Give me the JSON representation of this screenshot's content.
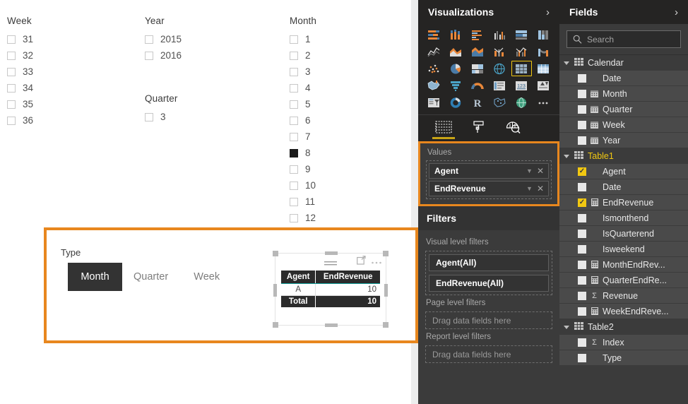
{
  "canvas": {
    "slicers": [
      {
        "name": "week-slicer",
        "title": "Week",
        "items": [
          {
            "label": "31",
            "checked": false
          },
          {
            "label": "32",
            "checked": false
          },
          {
            "label": "33",
            "checked": false
          },
          {
            "label": "34",
            "checked": false
          },
          {
            "label": "35",
            "checked": false
          },
          {
            "label": "36",
            "checked": false
          }
        ]
      },
      {
        "name": "year-slicer",
        "title": "Year",
        "items": [
          {
            "label": "2015",
            "checked": false
          },
          {
            "label": "2016",
            "checked": false
          }
        ]
      },
      {
        "name": "quarter-slicer",
        "title": "Quarter",
        "items": [
          {
            "label": "3",
            "checked": false
          }
        ]
      },
      {
        "name": "month-slicer",
        "title": "Month",
        "items": [
          {
            "label": "1",
            "checked": false
          },
          {
            "label": "2",
            "checked": false
          },
          {
            "label": "3",
            "checked": false
          },
          {
            "label": "4",
            "checked": false
          },
          {
            "label": "5",
            "checked": false
          },
          {
            "label": "6",
            "checked": false
          },
          {
            "label": "7",
            "checked": false
          },
          {
            "label": "8",
            "checked": true
          },
          {
            "label": "9",
            "checked": false
          },
          {
            "label": "10",
            "checked": false
          },
          {
            "label": "11",
            "checked": false
          },
          {
            "label": "12",
            "checked": false
          }
        ]
      }
    ],
    "report_region": {
      "type_label": "Type",
      "tiles": [
        {
          "label": "Month",
          "selected": true
        },
        {
          "label": "Quarter",
          "selected": false
        },
        {
          "label": "Week",
          "selected": false
        }
      ],
      "visual": {
        "header_icons": [
          "menu-lines-icon",
          "focus-mode-icon",
          "more-options-icon"
        ],
        "columns": [
          "Agent",
          "EndRevenue"
        ],
        "rows": [
          {
            "agent": "A",
            "endrevenue": "10"
          }
        ],
        "total": {
          "label": "Total",
          "endrevenue": "10"
        },
        "header_accent_color": "#12a19a",
        "header_bg_color": "#2b2b2b"
      }
    },
    "highlight_color": "#e8871e"
  },
  "visualizations": {
    "title": "Visualizations",
    "collapse_icon": "chevron-right-icon",
    "gallery": [
      {
        "name": "stacked-bar-chart",
        "selected": false
      },
      {
        "name": "stacked-column-chart",
        "selected": false
      },
      {
        "name": "clustered-bar-chart",
        "selected": false
      },
      {
        "name": "clustered-column-chart",
        "selected": false
      },
      {
        "name": "100-percent-stacked-bar-chart",
        "selected": false
      },
      {
        "name": "100-percent-stacked-column-chart",
        "selected": false
      },
      {
        "name": "line-chart",
        "selected": false
      },
      {
        "name": "area-chart",
        "selected": false
      },
      {
        "name": "stacked-area-chart",
        "selected": false
      },
      {
        "name": "line-and-stacked-column-chart",
        "selected": false
      },
      {
        "name": "line-and-clustered-column-chart",
        "selected": false
      },
      {
        "name": "ribbon-chart",
        "selected": false
      },
      {
        "name": "scatter-chart",
        "selected": false
      },
      {
        "name": "pie-chart",
        "selected": false
      },
      {
        "name": "treemap-chart",
        "selected": false
      },
      {
        "name": "map-visual",
        "selected": false
      },
      {
        "name": "table-visual",
        "selected": true
      },
      {
        "name": "matrix-visual",
        "selected": false
      },
      {
        "name": "filled-map-visual",
        "selected": false
      },
      {
        "name": "funnel-chart",
        "selected": false
      },
      {
        "name": "gauge-visual",
        "selected": false
      },
      {
        "name": "multi-row-card",
        "selected": false
      },
      {
        "name": "card-visual",
        "selected": false
      },
      {
        "name": "kpi-visual",
        "selected": false
      },
      {
        "name": "slicer-visual",
        "selected": false
      },
      {
        "name": "donut-chart",
        "selected": false
      },
      {
        "name": "r-script-visual",
        "selected": false
      },
      {
        "name": "shape-map-visual",
        "selected": false
      },
      {
        "name": "globe-map-visual",
        "selected": false
      },
      {
        "name": "more-visuals",
        "selected": false
      }
    ],
    "tabs": [
      {
        "name": "fields-tab",
        "icon": "fields-grid-icon",
        "active": true
      },
      {
        "name": "format-tab",
        "icon": "paint-roller-icon",
        "active": false
      },
      {
        "name": "analytics-tab",
        "icon": "analytics-magnifier-icon",
        "active": false
      }
    ],
    "wells": {
      "label": "Values",
      "fields": [
        {
          "name": "Agent"
        },
        {
          "name": "EndRevenue"
        }
      ],
      "highlight_color": "#e8871e"
    },
    "filters": {
      "title": "Filters",
      "sections": [
        {
          "label": "Visual level filters",
          "cards": [
            "Agent(All)",
            "EndRevenue(All)"
          ],
          "placeholder": null
        },
        {
          "label": "Page level filters",
          "cards": [],
          "placeholder": "Drag data fields here"
        },
        {
          "label": "Report level filters",
          "cards": [],
          "placeholder": "Drag data fields here"
        }
      ]
    }
  },
  "fields": {
    "title": "Fields",
    "collapse_icon": "chevron-right-icon",
    "search": {
      "placeholder": "Search",
      "value": "",
      "icon": "search-icon"
    },
    "tables": [
      {
        "name": "Calendar",
        "gold": false,
        "expanded": true,
        "fields": [
          {
            "label": "Date",
            "checked": false,
            "icon": "none"
          },
          {
            "label": "Month",
            "checked": false,
            "icon": "calendar"
          },
          {
            "label": "Quarter",
            "checked": false,
            "icon": "calendar"
          },
          {
            "label": "Week",
            "checked": false,
            "icon": "calendar"
          },
          {
            "label": "Year",
            "checked": false,
            "icon": "calendar"
          }
        ]
      },
      {
        "name": "Table1",
        "gold": true,
        "expanded": true,
        "fields": [
          {
            "label": "Agent",
            "checked": true,
            "icon": "none"
          },
          {
            "label": "Date",
            "checked": false,
            "icon": "none"
          },
          {
            "label": "EndRevenue",
            "checked": true,
            "icon": "measure"
          },
          {
            "label": "Ismonthend",
            "checked": false,
            "icon": "none"
          },
          {
            "label": "IsQuarterend",
            "checked": false,
            "icon": "none"
          },
          {
            "label": "Isweekend",
            "checked": false,
            "icon": "none"
          },
          {
            "label": "MonthEndRev...",
            "checked": false,
            "icon": "measure"
          },
          {
            "label": "QuarterEndRe...",
            "checked": false,
            "icon": "measure"
          },
          {
            "label": "Revenue",
            "checked": false,
            "icon": "sigma"
          },
          {
            "label": "WeekEndReve...",
            "checked": false,
            "icon": "measure"
          }
        ]
      },
      {
        "name": "Table2",
        "gold": false,
        "expanded": true,
        "fields": [
          {
            "label": "Index",
            "checked": false,
            "icon": "sigma"
          },
          {
            "label": "Type",
            "checked": false,
            "icon": "none"
          }
        ]
      }
    ]
  }
}
